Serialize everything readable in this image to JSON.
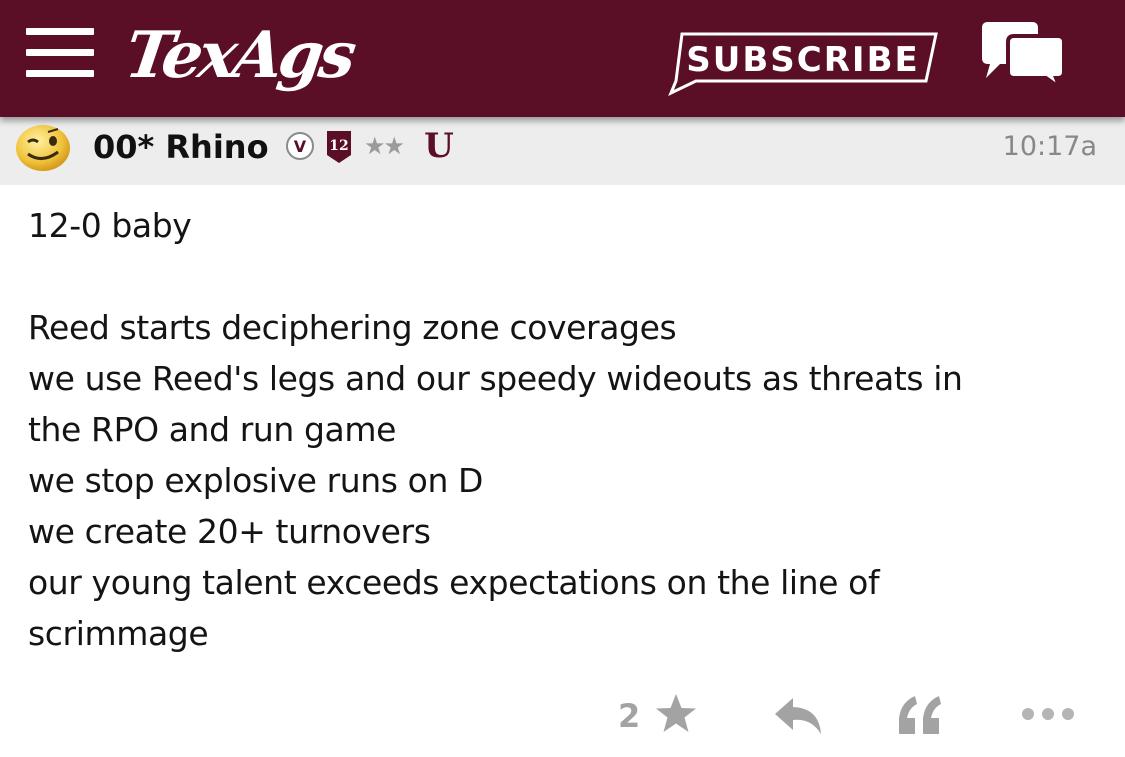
{
  "header": {
    "logo_text": "TexAgs",
    "subscribe_label": "SUBSCRIBE",
    "menu_icon": "hamburger-menu-icon",
    "chat_icon": "chat-bubbles-icon",
    "brand_color": "#5a0f26"
  },
  "post": {
    "author": "00* Rhino",
    "badges": {
      "v_label": "V",
      "twelfth_man_label": "12",
      "stars": "★★",
      "u_label": "U"
    },
    "timestamp": "10:17a",
    "body_lines": [
      "12-0 baby",
      "",
      "Reed starts deciphering zone coverages",
      "we use Reed's legs and our speedy wideouts as threats in",
      "the RPO and run game",
      "we stop explosive runs on D",
      "we create 20+ turnovers",
      "our young talent exceeds expectations on the line of",
      "scrimmage"
    ],
    "actions": {
      "star_count": "2",
      "star_icon": "star-icon",
      "reply_icon": "reply-icon",
      "quote_icon": "quote-icon",
      "more_icon": "more-dots-icon"
    }
  }
}
